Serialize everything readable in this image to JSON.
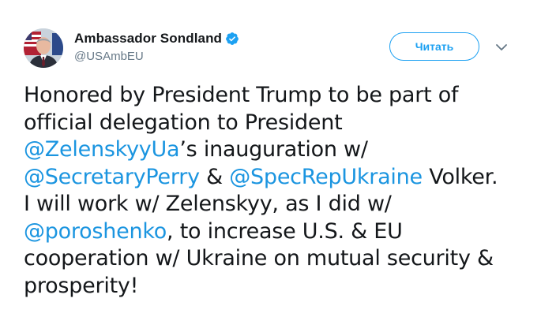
{
  "author": {
    "display_name": "Ambassador Sondland",
    "handle": "@USAmbEU",
    "verified_icon": "verified-badge-icon",
    "avatar_icon": "profile-photo"
  },
  "follow_button": {
    "label": "Читать"
  },
  "menu_caret_icon": "chevron-down-icon",
  "tweet": {
    "lines": [
      [
        {
          "t": "Honored by President Trump to be part of",
          "m": false
        }
      ],
      [
        {
          "t": "official delegation to President",
          "m": false
        }
      ],
      [
        {
          "t": "@ZelenskyyUa",
          "m": true
        },
        {
          "t": "’s inauguration w/",
          "m": false
        }
      ],
      [
        {
          "t": "@SecretaryPerry",
          "m": true
        },
        {
          "t": " & ",
          "m": false
        },
        {
          "t": "@SpecRepUkraine",
          "m": true
        },
        {
          "t": " Volker.",
          "m": false
        }
      ],
      [
        {
          "t": "I will work w/ Zelenskyy, as I did w/",
          "m": false
        }
      ],
      [
        {
          "t": "@poroshenko",
          "m": true
        },
        {
          "t": ", to increase U.S. & EU",
          "m": false
        }
      ],
      [
        {
          "t": "cooperation w/ Ukraine on mutual security &",
          "m": false
        }
      ],
      [
        {
          "t": "prosperity!",
          "m": false
        }
      ]
    ]
  },
  "colors": {
    "link": "#1b95e0",
    "accent": "#1da1f2",
    "text": "#14171a",
    "secondary": "#657786"
  }
}
